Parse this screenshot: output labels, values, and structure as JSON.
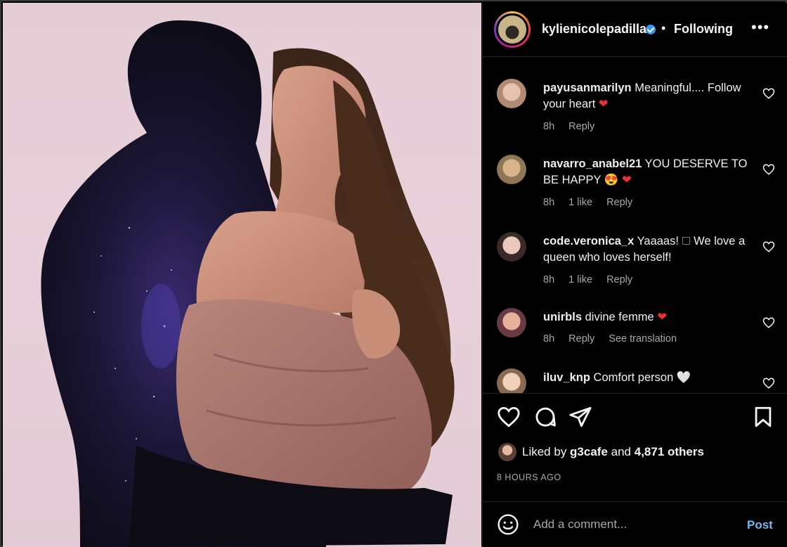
{
  "post": {
    "username": "kylienicolepadilla",
    "separator": "•",
    "follow_status": "Following",
    "more_label": "•••"
  },
  "comments": [
    {
      "user": "payusanmarilyn",
      "text": "Meaningful.... Follow your heart",
      "emoji": "❤",
      "time": "8h",
      "likes": "",
      "reply": "Reply",
      "extra": ""
    },
    {
      "user": "navarro_anabel21",
      "text": "YOU DESERVE TO BE HAPPY",
      "emoji": "😍 ❤",
      "time": "8h",
      "likes": "1 like",
      "reply": "Reply",
      "extra": ""
    },
    {
      "user": "code.veronica_x",
      "text": "Yaaaas! 🗆 We love a queen who loves herself!",
      "emoji": "",
      "time": "8h",
      "likes": "1 like",
      "reply": "Reply",
      "extra": ""
    },
    {
      "user": "unirbls",
      "text": "divine femme",
      "emoji": "❤",
      "time": "8h",
      "likes": "",
      "reply": "Reply",
      "extra": "See translation"
    },
    {
      "user": "iluv_knp",
      "text": "Comfort person",
      "emoji": "🤍",
      "time": "",
      "likes": "",
      "reply": "",
      "extra": ""
    }
  ],
  "likes": {
    "prefix": "Liked by ",
    "first_user": "g3cafe",
    "middle": " and ",
    "others": "4,871 others"
  },
  "time_ago": "8 HOURS AGO",
  "add_comment": {
    "placeholder": "Add a comment...",
    "post_label": "Post"
  },
  "icons": {
    "like": "heart-outline-icon",
    "comment": "speech-bubble-icon",
    "share": "paper-plane-icon",
    "save": "bookmark-icon",
    "emoji": "smiley-icon"
  },
  "colors": {
    "background": "#000000",
    "verified": "#3897f0",
    "link_blue": "#7ab7f0",
    "heart_red": "#ed2c3c",
    "photo_background": "#e5cdd6"
  }
}
